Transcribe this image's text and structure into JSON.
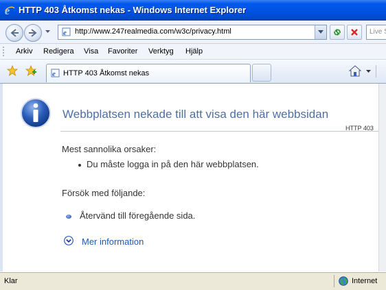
{
  "window": {
    "title": "HTTP 403 Åtkomst nekas - Windows Internet Explorer"
  },
  "address_bar": {
    "url": "http://www.247realmedia.com/w3c/privacy.html"
  },
  "search": {
    "placeholder": "Live S"
  },
  "menu": [
    {
      "label": "Arkiv"
    },
    {
      "label": "Redigera"
    },
    {
      "label": "Visa"
    },
    {
      "label": "Favoriter"
    },
    {
      "label": "Verktyg"
    },
    {
      "label": "Hjälp"
    }
  ],
  "tab": {
    "label": "HTTP 403 Åtkomst nekas"
  },
  "page": {
    "heading": "Webbplatsen nekade till att visa den här webbsidan",
    "error_code": "HTTP 403",
    "causes_heading": "Mest sannolika orsaker:",
    "causes": [
      "Du måste logga in på den här webbplatsen."
    ],
    "try_heading": "Försök med följande:",
    "try_items": [
      "Återvänd till föregående sida."
    ],
    "more_info": "Mer information"
  },
  "status": {
    "text": "Klar",
    "zone": "Internet"
  },
  "icons": {
    "ie_logo": "ie-logo-icon",
    "back": "back-arrow-icon",
    "forward": "forward-arrow-icon",
    "refresh": "refresh-icon",
    "stop": "stop-icon",
    "favorites": "favorites-star-icon",
    "add_favorites": "add-favorites-icon",
    "home": "home-icon",
    "info": "info-icon",
    "zone": "globe-icon"
  },
  "colors": {
    "titlebar": "#0054e3",
    "heading": "#4e6ea6",
    "link": "#1d5bb0",
    "statusbar": "#ece9d8"
  }
}
